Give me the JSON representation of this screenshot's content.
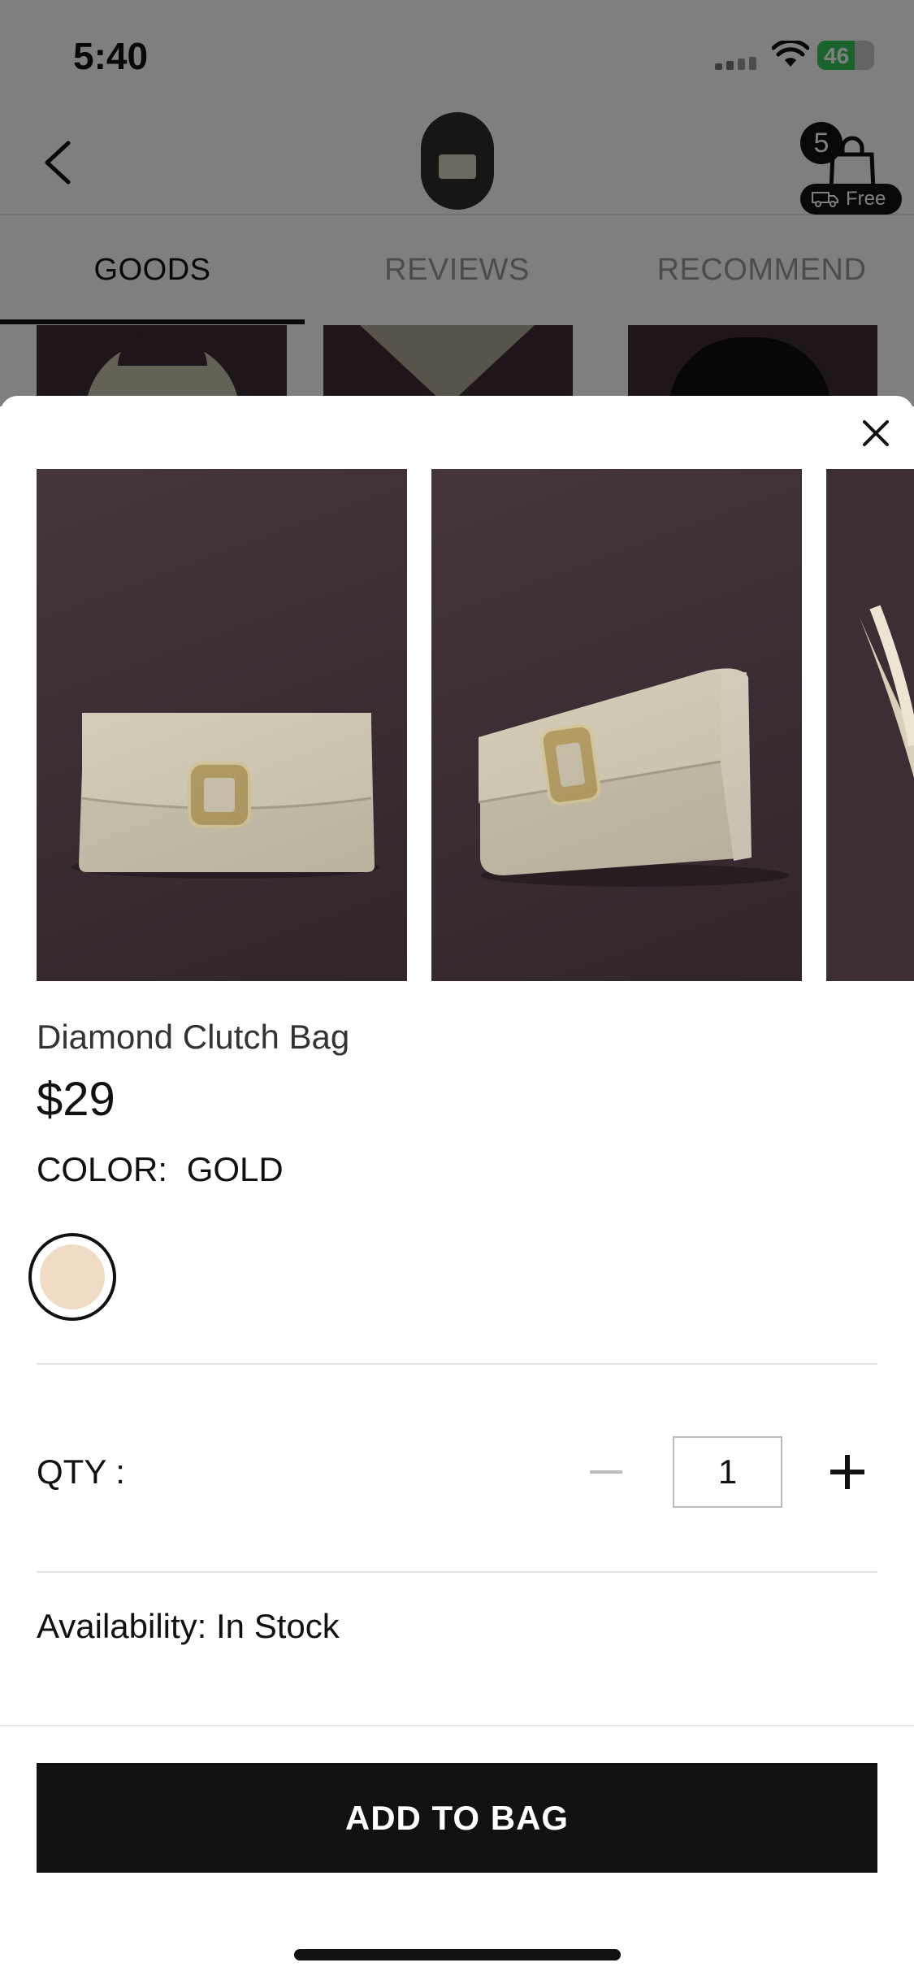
{
  "status_bar": {
    "time": "5:40",
    "battery": "46"
  },
  "header": {
    "cart_count": "5",
    "shipping_badge": "Free"
  },
  "tabs": [
    {
      "label": "GOODS",
      "active": true
    },
    {
      "label": "REVIEWS",
      "active": false
    },
    {
      "label": "RECOMMEND",
      "active": false
    }
  ],
  "product": {
    "name": "Diamond Clutch Bag",
    "price": "$29",
    "color_label": "COLOR:",
    "color_value": "GOLD",
    "swatch_color": "#f0dcc4",
    "qty_label": "QTY :",
    "qty_value": "1",
    "availability": "Availability: In Stock",
    "add_button": "ADD TO BAG"
  },
  "colors": {
    "photo_bg": "#3d2d35",
    "button_bg": "#111111",
    "accent_battery": "#34c759"
  },
  "icons": [
    "back-icon",
    "cart-icon",
    "truck-icon",
    "close-icon",
    "minus-icon",
    "plus-icon",
    "wifi-icon",
    "signal-icon"
  ]
}
